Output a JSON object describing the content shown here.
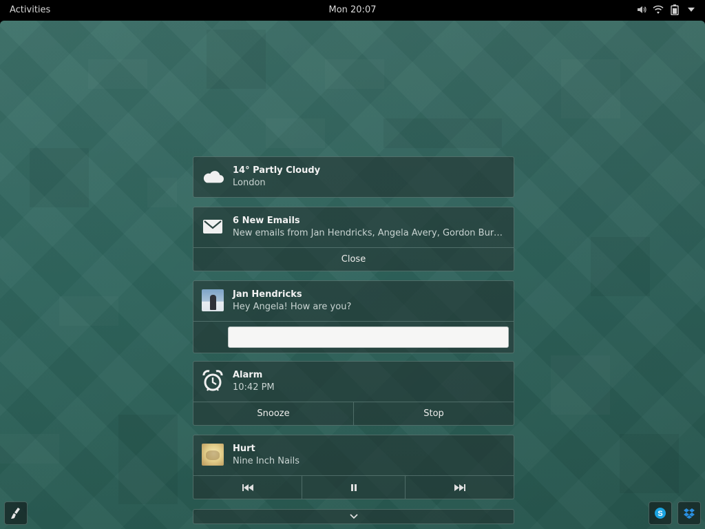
{
  "topbar": {
    "activities_label": "Activities",
    "clock": "Mon 20:07",
    "tray_icons": [
      "volume-icon",
      "wifi-icon",
      "battery-icon",
      "dropdown-arrow-icon"
    ]
  },
  "notifications": {
    "weather": {
      "icon": "cloud-icon",
      "title": "14° Partly Cloudy",
      "body": "London"
    },
    "email": {
      "icon": "envelope-icon",
      "title": "6 New Emails",
      "body": "New emails from Jan Hendricks, Angela Avery, Gordon Burns, ...",
      "action_close": "Close"
    },
    "chat": {
      "icon": "avatar",
      "title": "Jan Hendricks",
      "body": "Hey Angela! How are you?",
      "reply_value": "",
      "reply_placeholder": ""
    },
    "alarm": {
      "icon": "alarm-clock-icon",
      "title": "Alarm",
      "body": "10:42 PM",
      "action_snooze": "Snooze",
      "action_stop": "Stop"
    },
    "music": {
      "icon": "album-art",
      "title": "Hurt",
      "body": "Nine Inch Nails",
      "controls": [
        "previous-track-icon",
        "pause-icon",
        "next-track-icon"
      ]
    }
  },
  "bottom": {
    "expand_icon": "chevron-down-icon",
    "left_icon": "brush-icon",
    "right_icons": [
      "skype-icon",
      "dropbox-icon"
    ]
  }
}
